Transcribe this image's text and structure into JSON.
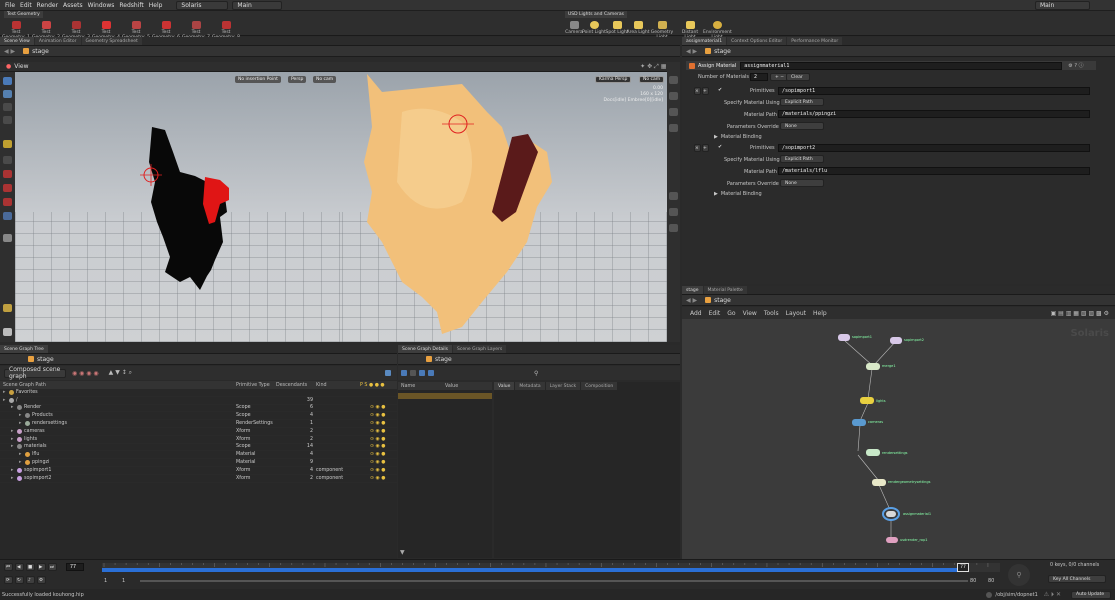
{
  "menubar": {
    "items": [
      "File",
      "Edit",
      "Render",
      "Assets",
      "Windows",
      "Redshift",
      "Help"
    ],
    "desktop": "Solaris",
    "context": "Main",
    "right_context": "Main"
  },
  "shelf": {
    "left_tab": "Test Geometry",
    "left_tools": [
      "Test Geometry: 1",
      "Test Geometry: 2",
      "Test Geometry: 3",
      "Test Geometry: 4",
      "Test Geometry: 5",
      "Test Geometry: 6",
      "Test Geometry: 7",
      "Test Geometry: 8"
    ],
    "right_tab": "USD Lights and Cameras",
    "right_tools": [
      "Camera",
      "Point Light",
      "Spot Light",
      "Area Light",
      "Geometry Light",
      "Distant Light",
      "Environment Light"
    ]
  },
  "left_tabs": [
    "Scene View",
    "Animation Editor",
    "Geometry Spreadsheet"
  ],
  "stage_path": "stage",
  "viewport": {
    "label": "View",
    "camera_left": "Persp",
    "no_cam": "No cam",
    "insertion": "No insertion Point",
    "karma": "Karma Persp",
    "no_cam_right": "No cam",
    "stats": [
      "0.00",
      "160 x 120",
      "Docs[idle] Embree[0][idle]"
    ]
  },
  "right_tabs": [
    "assignmaterial1",
    "Context Options Editor",
    "Performance Monitor"
  ],
  "param_pane": {
    "op_type": "Assign Material",
    "op_name": "assignmaterial1",
    "num_materials_label": "Number of Materials",
    "num_materials_value": "2",
    "clear_label": "Clear",
    "blocks": [
      {
        "primitives_label": "Primitives",
        "primitives": "/sopimport1",
        "specify_label": "Specify Material Using",
        "specify": "Explicit Path",
        "path_label": "Material Path",
        "path": "/materials/ppingzi",
        "override_label": "Parameters Override",
        "override": "None",
        "binding": "Material Binding"
      },
      {
        "primitives_label": "Primitives",
        "primitives": "/sopimport2",
        "specify_label": "Specify Material Using",
        "specify": "Explicit Path",
        "path_label": "Material Path",
        "path": "/materials/lflu",
        "override_label": "Parameters Override",
        "override": "None",
        "binding": "Material Binding"
      }
    ]
  },
  "scene_graph": {
    "tabs": [
      "Scene Graph Tree"
    ],
    "filter": "Composed scene graph",
    "columns": [
      "Scene Graph Path",
      "Primitive Type",
      "Descendants",
      "Kind"
    ],
    "rows": [
      {
        "name": "Favorites",
        "type": "",
        "desc": "",
        "kind": "",
        "indent": 0,
        "icon": "folder"
      },
      {
        "name": "/",
        "type": "",
        "desc": "39",
        "kind": "",
        "indent": 0,
        "icon": "root"
      },
      {
        "name": "Render",
        "type": "Scope",
        "desc": "6",
        "kind": "",
        "indent": 1,
        "icon": "scope"
      },
      {
        "name": "Products",
        "type": "Scope",
        "desc": "4",
        "kind": "",
        "indent": 2,
        "icon": "scope"
      },
      {
        "name": "rendersettings",
        "type": "RenderSettings",
        "desc": "1",
        "kind": "",
        "indent": 2,
        "icon": "settings"
      },
      {
        "name": "cameras",
        "type": "Xform",
        "desc": "2",
        "kind": "",
        "indent": 1,
        "icon": "xform"
      },
      {
        "name": "lights",
        "type": "Xform",
        "desc": "2",
        "kind": "",
        "indent": 1,
        "icon": "xform"
      },
      {
        "name": "materials",
        "type": "Scope",
        "desc": "14",
        "kind": "",
        "indent": 1,
        "icon": "scope"
      },
      {
        "name": "lflu",
        "type": "Material",
        "desc": "4",
        "kind": "",
        "indent": 2,
        "icon": "material"
      },
      {
        "name": "ppingzi",
        "type": "Material",
        "desc": "9",
        "kind": "",
        "indent": 2,
        "icon": "material"
      },
      {
        "name": "sopimport1",
        "type": "Xform",
        "desc": "4",
        "kind": "component",
        "indent": 1,
        "icon": "geo"
      },
      {
        "name": "sopimport2",
        "type": "Xform",
        "desc": "2",
        "kind": "component",
        "indent": 1,
        "icon": "geo"
      }
    ]
  },
  "details": {
    "tabs": [
      "Scene Graph Details",
      "Scene Graph Layers"
    ],
    "columns": [
      "Name",
      "Value"
    ],
    "subtabs": [
      "Value",
      "Metadata",
      "Layer Stack",
      "Composition"
    ]
  },
  "network": {
    "tabs": [
      "stage",
      "Material Palette"
    ],
    "menu": [
      "Add",
      "Edit",
      "Go",
      "View",
      "Tools",
      "Layout",
      "Help"
    ],
    "watermark": "Solaris",
    "nodes": [
      "sopimport1",
      "sopimport2",
      "merge1",
      "lights",
      "cameras",
      "rendersettings",
      "rendergeometrysettings",
      "assignmaterial1",
      "usdrender_rop1"
    ]
  },
  "timeline": {
    "frame": "77",
    "start": "1",
    "start2": "1",
    "end": "80",
    "end2": "80",
    "ticks": [
      "1",
      "",
      "",
      "",
      "",
      "",
      "",
      "",
      "",
      "",
      "",
      "",
      "",
      "",
      "",
      "",
      "",
      "",
      "",
      "",
      "",
      "",
      "",
      "",
      "",
      "",
      "",
      "",
      "",
      "",
      "",
      "",
      "",
      "",
      "",
      "",
      "",
      "",
      "",
      "",
      "",
      "",
      "",
      "",
      "",
      "",
      "",
      "",
      "",
      "",
      "",
      "",
      "",
      "",
      "",
      "",
      "",
      "",
      "",
      "",
      "",
      "",
      "",
      "",
      "",
      "",
      "",
      "",
      "",
      "",
      "",
      "",
      "",
      "",
      "",
      "",
      "",
      "77",
      "",
      "",
      ""
    ],
    "keys": "0 keys, 0/0 channels",
    "key_all": "Key All Channels"
  },
  "status": {
    "message": "Successfully loaded kouhong.hip",
    "path": "/obj/sim/dopnet1",
    "update": "Auto Update"
  },
  "colors": {
    "accent": "#f0a030",
    "node_selected": "#5aa0e6",
    "timebar": "#2a6fd6"
  }
}
